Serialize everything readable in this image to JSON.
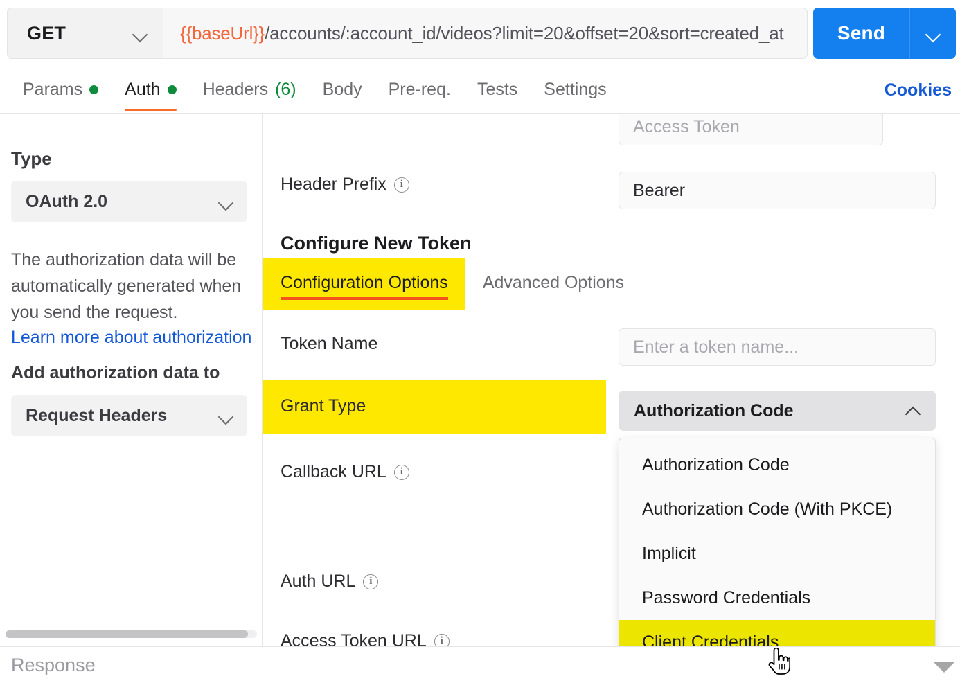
{
  "request": {
    "method": "GET",
    "method_icon": "chevron-down-icon",
    "url_variable": "{{baseUrl}}",
    "url_path": "/accounts/:account_id/videos?limit=20&offset=20&sort=created_at",
    "send_label": "Send",
    "send_caret_icon": "chevron-down-icon"
  },
  "tabs": [
    {
      "label": "Params",
      "dot": true,
      "active": false
    },
    {
      "label": "Auth",
      "dot": true,
      "active": true
    },
    {
      "label": "Headers",
      "count": "(6)",
      "active": false
    },
    {
      "label": "Body",
      "active": false
    },
    {
      "label": "Pre-req.",
      "active": false
    },
    {
      "label": "Tests",
      "active": false
    },
    {
      "label": "Settings",
      "active": false
    }
  ],
  "cookies_label": "Cookies",
  "sidebar": {
    "type_label": "Type",
    "type_value": "OAuth 2.0",
    "type_caret_icon": "chevron-down-icon",
    "description": "The authorization data will be automatically generated when you send the request.",
    "link_label": "Learn more about authorization",
    "add_to_label": "Add authorization data to",
    "add_to_value": "Request Headers",
    "add_to_caret_icon": "chevron-down-icon",
    "scrollbar": "horizontal-scrollbar"
  },
  "auth_form": {
    "access_token_placeholder": "Access Token",
    "refresh_icon": "refresh-disabled-icon",
    "header_prefix_label": "Header Prefix",
    "header_prefix_info_icon": "info-icon",
    "header_prefix_value": "Bearer",
    "section_title": "Configure New Token",
    "subtabs": [
      {
        "label": "Configuration Options",
        "active": true,
        "highlighted": true
      },
      {
        "label": "Advanced Options",
        "active": false,
        "highlighted": false
      }
    ],
    "token_name_label": "Token Name",
    "token_name_placeholder": "Enter a token name...",
    "grant_type_label": "Grant Type",
    "grant_type_value": "Authorization Code",
    "grant_type_caret_icon": "chevron-up-icon",
    "grant_type_options": [
      {
        "label": "Authorization Code",
        "highlighted": false
      },
      {
        "label": "Authorization Code (With PKCE)",
        "highlighted": false
      },
      {
        "label": "Implicit",
        "highlighted": false
      },
      {
        "label": "Password Credentials",
        "highlighted": false
      },
      {
        "label": "Client Credentials",
        "highlighted": true
      }
    ],
    "callback_url_label": "Callback URL",
    "callback_url_info_icon": "info-icon",
    "auth_url_label": "Auth URL",
    "auth_url_info_icon": "info-icon",
    "access_token_url_label": "Access Token URL",
    "access_token_url_info_icon": "info-icon"
  },
  "footer": {
    "response_label": "Response",
    "scroll_indicator_icon": "triangle-down-icon"
  },
  "colors": {
    "accent_blue": "#1480f0",
    "link_blue": "#1558d6",
    "highlight_yellow": "#ffe800",
    "menu_highlight_yellow": "#ece500",
    "status_green": "#0f8b3d",
    "tab_underline_orange": "#fa6a28",
    "url_variable_orange": "#f2683c"
  }
}
